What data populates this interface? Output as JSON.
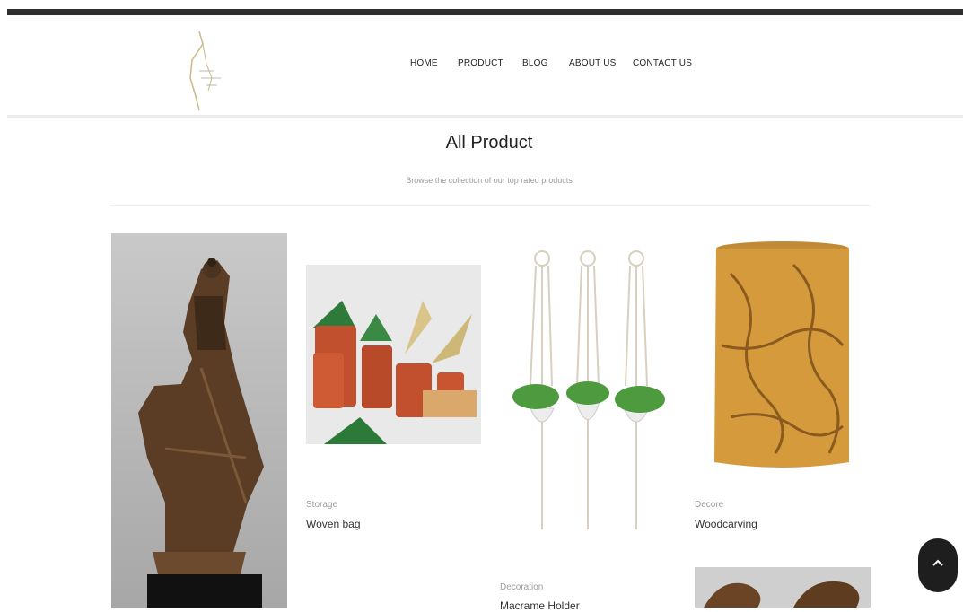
{
  "nav": {
    "items": [
      {
        "label": "HOME"
      },
      {
        "label": "PRODUCT"
      },
      {
        "label": "BLOG"
      },
      {
        "label": "ABOUT US"
      },
      {
        "label": "CONTACT US"
      }
    ]
  },
  "section": {
    "title": "All Product",
    "subtitle": "Browse the collection of our top rated products"
  },
  "products": [
    {
      "category": "Storage",
      "name": "Woven bag"
    },
    {
      "category": "Decoration",
      "name": "Macrame Holder"
    },
    {
      "category": "Decore",
      "name": "Woodcarving"
    }
  ],
  "icons": {
    "scroll_top": "chevron-up-icon",
    "logo": "brand-logo"
  },
  "colors": {
    "topbar": "#2f2f2f",
    "scroll_button": "#1e1e1e"
  }
}
